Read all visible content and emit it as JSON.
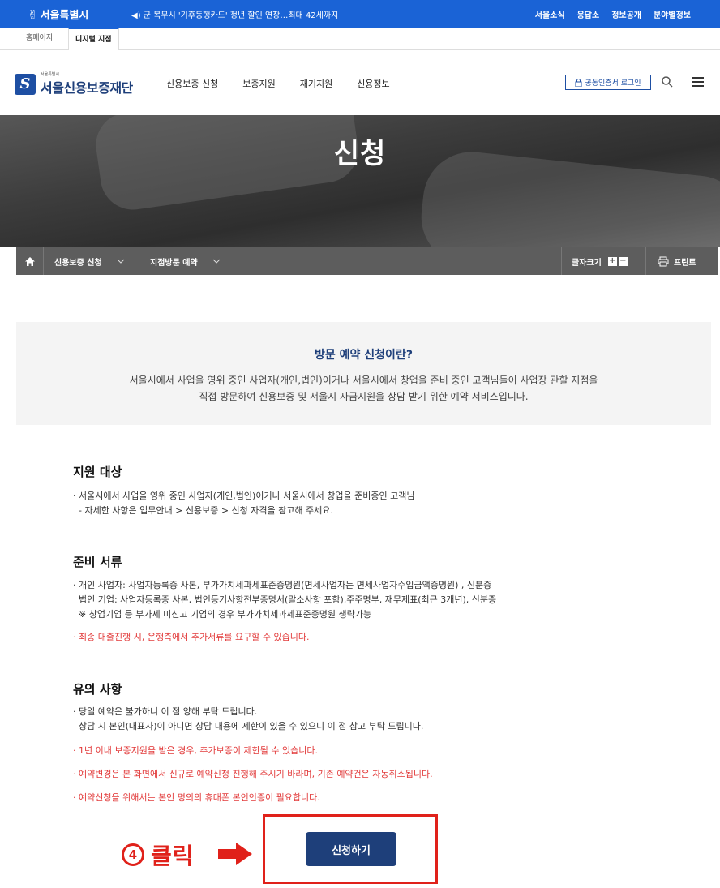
{
  "topbar": {
    "logo_text": "서울특별시",
    "notice": "◀) 군 복무시 '기후동행카드' 청년 할인 연장…최대 42세까지",
    "links": [
      "서울소식",
      "응답소",
      "정보공개",
      "분야별정보"
    ]
  },
  "subtabs": [
    "홈페이지",
    "디지털 지점"
  ],
  "header": {
    "brand_small": "서울특별시",
    "brand_name": "서울신용보증재단",
    "brand_mark": "S",
    "nav": [
      "신용보증 신청",
      "보증지원",
      "재기지원",
      "신용정보"
    ],
    "cert_login": "공동인증서 로그인"
  },
  "hero": {
    "title": "신청"
  },
  "location": {
    "crumb1": "신용보증 신청",
    "crumb2": "지점방문 예약",
    "font_size_label": "글자크기",
    "print_label": "프린트"
  },
  "intro": {
    "title": "방문 예약 신청이란?",
    "line1": "서울시에서 사업을 영위 중인 사업자(개인,법인)이거나 서울시에서 창업을 준비 중인 고객님들이 사업장 관할 지점을",
    "line2": "직접 방문하여 신용보증 및 서울시 자금지원을 상담 받기 위한 예약 서비스입니다."
  },
  "section1": {
    "title": "지원 대상",
    "lines": [
      "· 서울시에서 사업을 영위 중인 사업자(개인,법인)이거나 서울시에서 창업을 준비중인 고객님",
      "  - 자세한 사항은 업무안내 > 신용보증 > 신청 자격을 참고해 주세요."
    ]
  },
  "section2": {
    "title": "준비 서류",
    "lines": [
      "· 개인 사업자: 사업자등록증 사본, 부가가치세과세표준증명원(면세사업자는 면세사업자수입금액증명원) , 신분증",
      "  법인 기업: 사업자등록증 사본, 법인등기사항전부증명서(말소사항 포함),주주명부, 재무제표(최근 3개년), 신분증",
      "  ※ 창업기업 등 부가세 미신고 기업의 경우 부가가치세과세표준증명원 생략가능"
    ],
    "red": "· 최종 대출진행 시, 은행측에서 추가서류를 요구할 수 있습니다."
  },
  "section3": {
    "title": "유의 사항",
    "lines": [
      "· 당일 예약은 불가하니 이 점 양해 부탁 드립니다.",
      "  상담 시 본인(대표자)이 아니면 상담 내용에 제한이 있을 수 있으니 이 점 참고 부탁 드립니다."
    ],
    "red": [
      "· 1년 이내 보증지원을 받은 경우, 추가보증이 제한될 수 있습니다.",
      "· 예약변경은 본 화면에서 신규로 예약신청 진행해 주시기 바라며, 기존 예약건은 자동취소됩니다.",
      "· 예약신청을 위해서는 본인 명의의 휴대폰 본인인증이 필요합니다."
    ]
  },
  "annotation": {
    "num": "4",
    "word": "클릭"
  },
  "apply_button": "신청하기"
}
